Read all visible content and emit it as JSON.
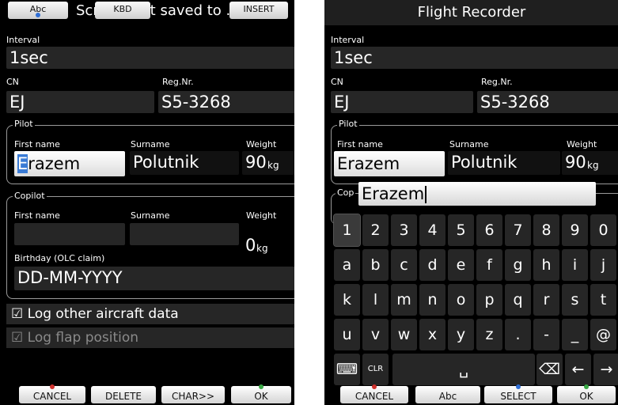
{
  "left": {
    "topbar": {
      "abc": "Abc",
      "kbd": "KBD",
      "insert": "INSERT",
      "message": "Screenshot saved to ."
    },
    "interval_label": "Interval",
    "interval_value": "1sec",
    "cn_label": "CN",
    "cn_value": "EJ",
    "reg_label": "Reg.Nr.",
    "reg_value": "S5-3268",
    "pilot": {
      "legend": "Pilot",
      "first_label": "First name",
      "surname_label": "Surname",
      "weight_label": "Weight",
      "first_value_cursor": "E",
      "first_value_rest": "razem",
      "surname_value": "Polutnik",
      "weight_value": "90",
      "weight_unit": "kg"
    },
    "copilot": {
      "legend": "Copilot",
      "first_label": "First name",
      "surname_label": "Surname",
      "weight_label": "Weight",
      "weight_value": "0",
      "weight_unit": "kg",
      "birthday_label": "Birthday (OLC claim)",
      "birthday_value": "DD-MM-YYYY"
    },
    "check_log_other": "☑ Log other aircraft data",
    "check_log_flap": "☑ Log flap position",
    "buttons": {
      "cancel": "CANCEL",
      "delete": "DELETE",
      "char": "CHAR>>",
      "ok": "OK"
    }
  },
  "right": {
    "title": "Flight Recorder",
    "interval_label": "Interval",
    "interval_value": "1sec",
    "cn_label": "CN",
    "cn_value": "EJ",
    "reg_label": "Reg.Nr.",
    "reg_value": "S5-3268",
    "pilot": {
      "legend": "Pilot",
      "first_label": "First name",
      "surname_label": "Surname",
      "weight_label": "Weight",
      "first_value": "Erazem",
      "surname_value": "Polutnik",
      "weight_value": "90",
      "weight_unit": "kg"
    },
    "copilot_legend_partial": "Cop",
    "keyboard": {
      "input_value": "Erazem",
      "row1": [
        "1",
        "2",
        "3",
        "4",
        "5",
        "6",
        "7",
        "8",
        "9",
        "0"
      ],
      "row2": [
        "a",
        "b",
        "c",
        "d",
        "e",
        "f",
        "g",
        "h",
        "i",
        "j"
      ],
      "row3": [
        "k",
        "l",
        "m",
        "n",
        "o",
        "p",
        "q",
        "r",
        "s",
        "t"
      ],
      "row4": [
        "u",
        "v",
        "w",
        "x",
        "y",
        "z",
        ".",
        "-",
        "_",
        "@"
      ],
      "clr": "CLR",
      "space": "␣",
      "backspace": "⌫",
      "left_arrow": "←",
      "right_arrow": "→",
      "keyboard_icon": "keyboard-icon"
    },
    "buttons": {
      "cancel": "CANCEL",
      "abc": "Abc",
      "select": "SELECT",
      "ok": "OK"
    }
  },
  "colors": {
    "red_dot": "#d0312d",
    "blue_dot": "#2f6fd6",
    "green_dot": "#39a845",
    "cursor": "#3a7bd5"
  }
}
